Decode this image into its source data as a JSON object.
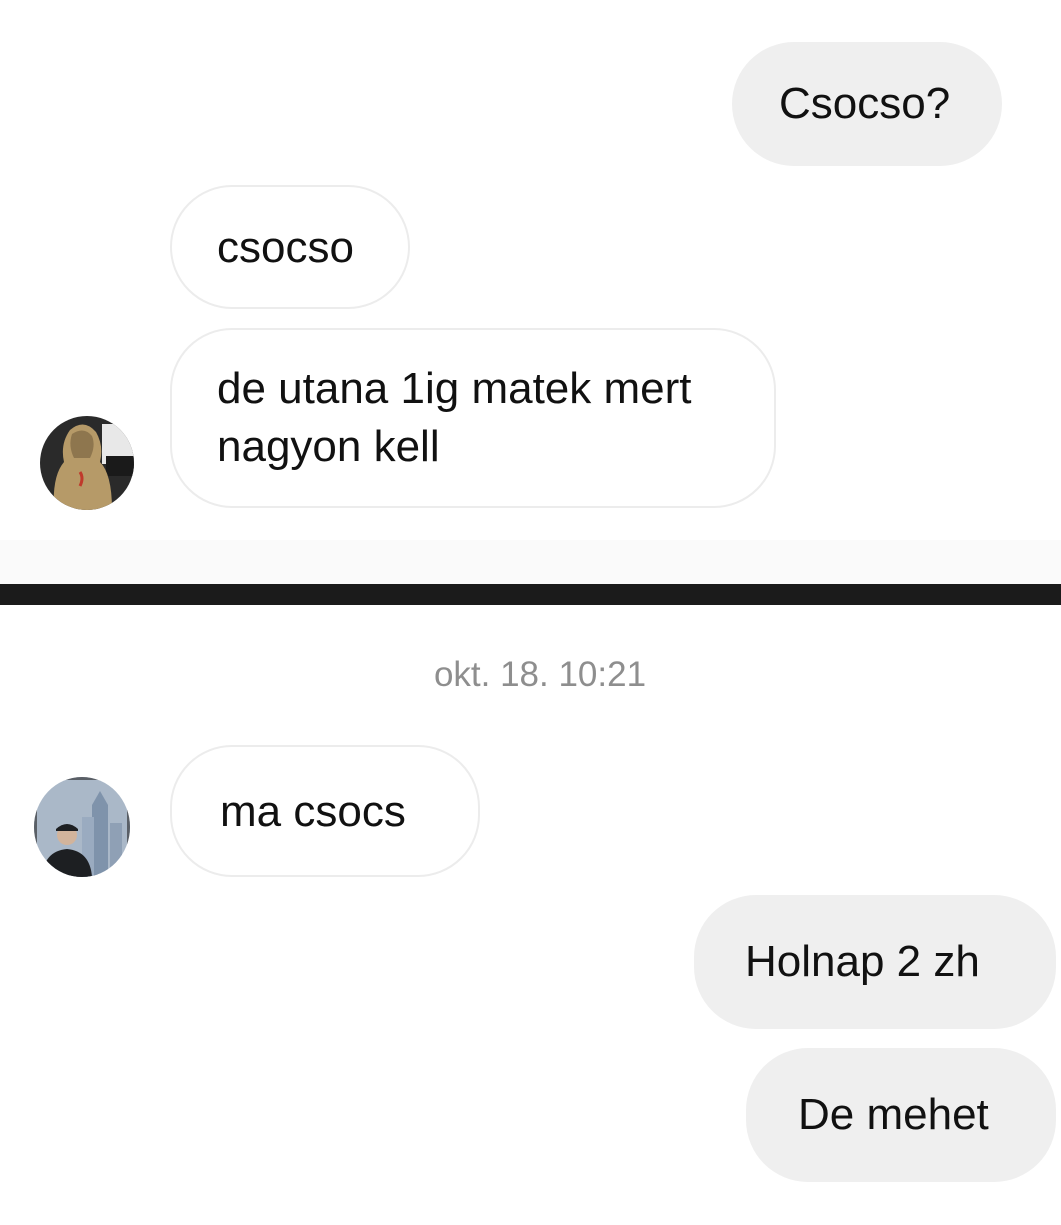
{
  "top_conversation": {
    "messages": [
      {
        "sender": "me",
        "text": "Csocso?"
      },
      {
        "sender": "them",
        "text": "csocso"
      },
      {
        "sender": "them",
        "lines": [
          "de utana 1ig matek mert",
          "nagyon kell"
        ]
      }
    ],
    "avatar": {
      "icon": "profile-photo-hooded-person",
      "colors": {
        "bg": "#2a2a2a",
        "hoodie": "#b69a68"
      }
    }
  },
  "bottom_conversation": {
    "timestamp": "okt. 18. 10:21",
    "messages": [
      {
        "sender": "them",
        "text": "ma csocs"
      },
      {
        "sender": "me",
        "text": "Holnap 2 zh"
      },
      {
        "sender": "me",
        "text": "De mehet"
      }
    ],
    "avatar": {
      "icon": "profile-photo-person-city",
      "colors": {
        "sky": "#aab8c8",
        "building": "#7f93ab",
        "person": "#1d1f22"
      }
    }
  },
  "theme": {
    "outgoing_bubble": "#efefef",
    "incoming_border": "#ececec",
    "divider": "#1b1b1b",
    "timestamp_text": "#8e8e8e"
  }
}
